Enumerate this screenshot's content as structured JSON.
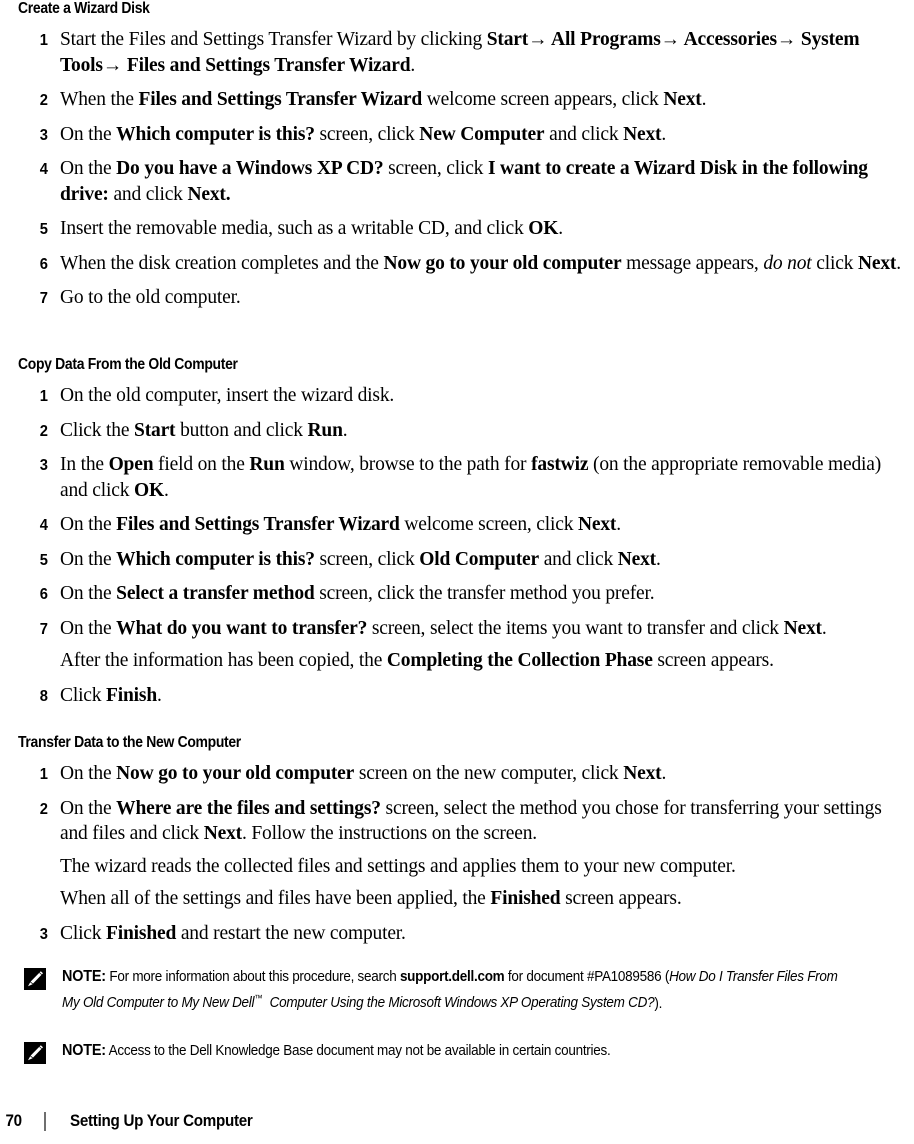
{
  "page": {
    "number": "70",
    "footer_title": "Setting Up Your Computer",
    "footer_separator": "|"
  },
  "sections": [
    {
      "heading": "Create a Wizard Disk",
      "steps": [
        {
          "num": "1",
          "text": "Start the Files and Settings Transfer Wizard by clicking Start→ All Programs→ Accessories→ System Tools→ Files and Settings Transfer Wizard."
        },
        {
          "num": "2",
          "text": "When the Files and Settings Transfer Wizard welcome screen appears, click Next."
        },
        {
          "num": "3",
          "text": "On the Which computer is this? screen, click New Computer and click Next."
        },
        {
          "num": "4",
          "text": "On the Do you have a Windows XP CD? screen, click I want to create a Wizard Disk in the following drive: and click Next."
        },
        {
          "num": "5",
          "text": "Insert the removable media, such as a writable CD, and click OK."
        },
        {
          "num": "6",
          "text": "When the disk creation completes and the Now go to your old computer message appears, do not click Next."
        },
        {
          "num": "7",
          "text": "Go to the old computer."
        }
      ]
    },
    {
      "heading": "Copy Data From the Old Computer",
      "steps": [
        {
          "num": "1",
          "text": "On the old computer, insert the wizard disk."
        },
        {
          "num": "2",
          "text": "Click the Start button and click Run."
        },
        {
          "num": "3",
          "text": "In the Open field on the Run window, browse to the path for fastwiz (on the appropriate removable media) and click OK."
        },
        {
          "num": "4",
          "text": "On the Files and Settings Transfer Wizard welcome screen, click Next."
        },
        {
          "num": "5",
          "text": "On the Which computer is this? screen, click Old Computer and click Next."
        },
        {
          "num": "6",
          "text": "On the Select a transfer method screen, click the transfer method you prefer."
        },
        {
          "num": "7",
          "text": "On the What do you want to transfer? screen, select the items you want to transfer and click Next.",
          "sub": "After the information has been copied, the Completing the Collection Phase screen appears."
        },
        {
          "num": "8",
          "text": "Click Finish."
        }
      ]
    },
    {
      "heading": "Transfer Data to the New Computer",
      "steps": [
        {
          "num": "1",
          "text": "On the Now go to your old computer screen on the new computer, click Next."
        },
        {
          "num": "2",
          "text": "On the Where are the files and settings? screen, select the method you chose for transferring your settings and files and click Next. Follow the instructions on the screen.",
          "sub": "The wizard reads the collected files and settings and applies them to your new computer.",
          "sub2": "When all of the settings and files have been applied, the Finished screen appears."
        },
        {
          "num": "3",
          "text": "Click Finished and restart the new computer."
        }
      ]
    }
  ],
  "notes": [
    {
      "label": "NOTE:",
      "text": "For more information about this procedure, search support.dell.com for document #PA1089586 (How Do I Transfer Files From My Old Computer to My New Dell™ Computer Using the Microsoft Windows XP Operating System CD?).",
      "icon": "pencil-note-icon"
    },
    {
      "label": "NOTE:",
      "text": "Access to the Dell Knowledge Base document may not be available in certain countries.",
      "icon": "pencil-note-icon"
    }
  ]
}
